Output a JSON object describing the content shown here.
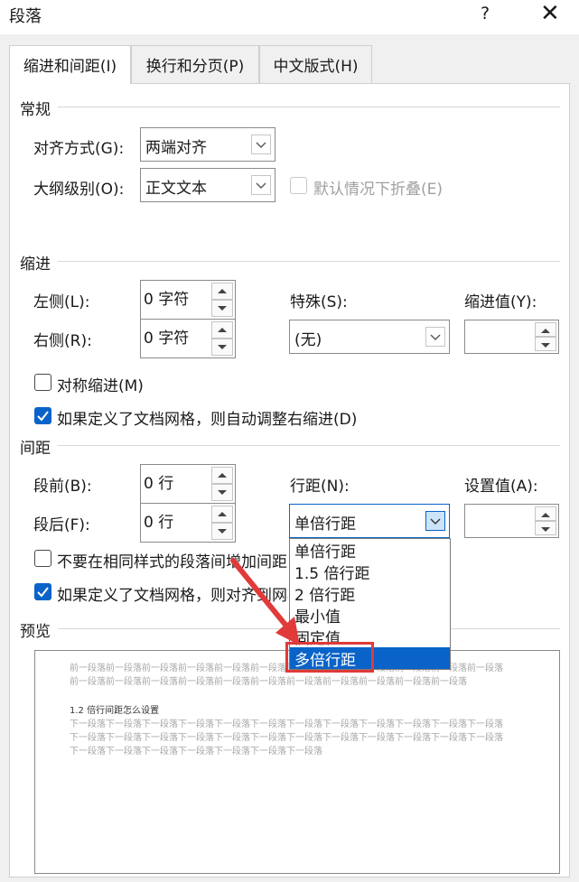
{
  "window": {
    "title": "段落",
    "help": "?",
    "close": "✕"
  },
  "tabs": [
    {
      "label": "缩进和间距(I)",
      "active": true
    },
    {
      "label": "换行和分页(P)",
      "active": false
    },
    {
      "label": "中文版式(H)",
      "active": false
    }
  ],
  "general": {
    "heading": "常规",
    "alignment_label": "对齐方式(G):",
    "alignment_value": "两端对齐",
    "outline_label": "大纲级别(O):",
    "outline_value": "正文文本",
    "collapse_label": "默认情况下折叠(E)"
  },
  "indent": {
    "heading": "缩进",
    "left_label": "左侧(L):",
    "left_value": "0 字符",
    "right_label": "右侧(R):",
    "right_value": "0 字符",
    "special_label": "特殊(S):",
    "special_value": "(无)",
    "indent_by_label": "缩进值(Y):",
    "indent_by_value": "",
    "mirror_label": "对称缩进(M)",
    "mirror_checked": false,
    "auto_adjust_label": "如果定义了文档网格，则自动调整右缩进(D)",
    "auto_adjust_checked": true
  },
  "spacing": {
    "heading": "间距",
    "before_label": "段前(B):",
    "before_value": "0 行",
    "after_label": "段后(F):",
    "after_value": "0 行",
    "line_spacing_label": "行距(N):",
    "line_spacing_value": "单倍行距",
    "at_label": "设置值(A):",
    "at_value": "",
    "no_space_label": "不要在相同样式的段落间增加间距",
    "no_space_checked": false,
    "snap_grid_label": "如果定义了文档网格，则对齐到网格",
    "snap_grid_checked": true
  },
  "dropdown": {
    "options": [
      "单倍行距",
      "1.5 倍行距",
      "2 倍行距",
      "最小值",
      "固定值",
      "多倍行距"
    ],
    "selected": "多倍行距"
  },
  "preview": {
    "heading": "预览",
    "prev_text": "前一段落前一段落前一段落前一段落前一段落前一段落前一段落前一段落前一段落前一段落前一段落前一段落前一段落前一段落前一段落前一段落前一段落前一段落前一段落前一段落前一段落前一段落前一段落",
    "current_text": "1.2 倍行间距怎么设置",
    "next_text": "下一段落下一段落下一段落下一段落下一段落下一段落下一段落下一段落下一段落下一段落下一段落下一段落下一段落下一段落下一段落下一段落下一段落下一段落下一段落下一段落下一段落下一段落下一段落下一段落下一段落下一段落下一段落下一段落下一段落下一段落下一段落"
  },
  "colors": {
    "accent": "#0a63c9",
    "highlight_box": "#e03a3a",
    "arrow": "#e03a3a"
  }
}
